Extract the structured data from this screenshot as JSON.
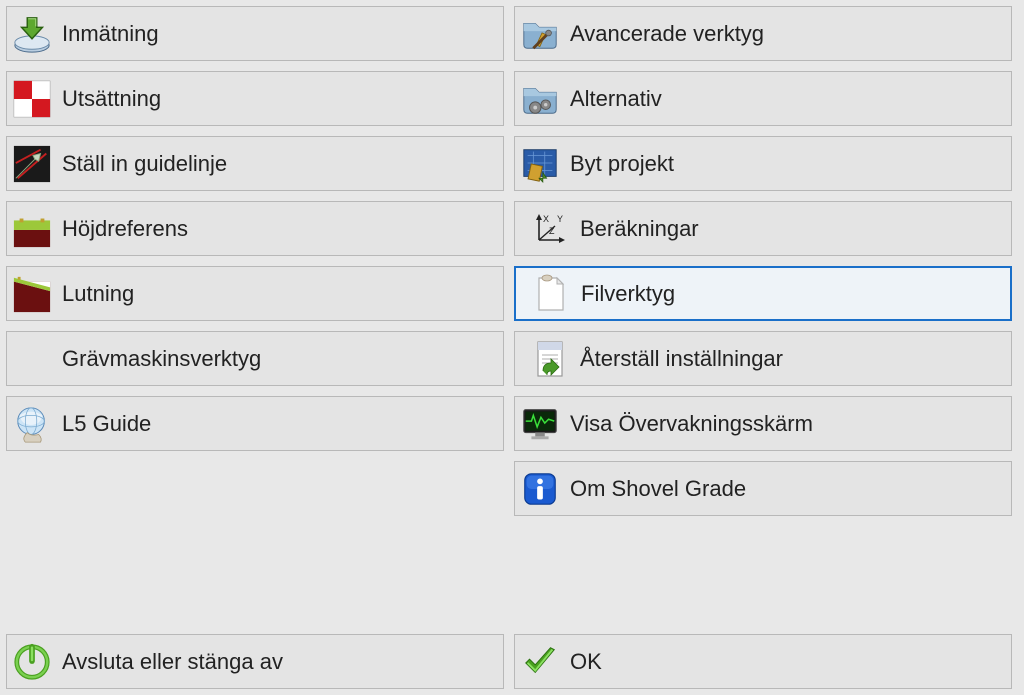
{
  "leftColumn": [
    {
      "id": "inmatning",
      "label": "Inmätning",
      "icon": "download-disk"
    },
    {
      "id": "utsattning",
      "label": "Utsättning",
      "icon": "red-squares"
    },
    {
      "id": "guidelinje",
      "label": "Ställ in guidelinje",
      "icon": "guideline-arrow"
    },
    {
      "id": "hojdreferens",
      "label": "Höjdreferens",
      "icon": "height-ref"
    },
    {
      "id": "lutning",
      "label": "Lutning",
      "icon": "slope"
    },
    {
      "id": "gravmaskin",
      "label": "Grävmaskinsverktyg",
      "icon": null
    },
    {
      "id": "l5guide",
      "label": "L5 Guide",
      "icon": "globe"
    }
  ],
  "rightColumn": [
    {
      "id": "avancerade",
      "label": "Avancerade verktyg",
      "icon": "folder-tools"
    },
    {
      "id": "alternativ",
      "label": "Alternativ",
      "icon": "folder-gears"
    },
    {
      "id": "bytprojekt",
      "label": "Byt projekt",
      "icon": "blueprint"
    },
    {
      "id": "berakningar",
      "label": "Beräkningar",
      "icon": "axes"
    },
    {
      "id": "filverktyg",
      "label": "Filverktyg",
      "icon": "file",
      "selected": true
    },
    {
      "id": "aterstall",
      "label": "Återställ inställningar",
      "icon": "restore-page"
    },
    {
      "id": "overvak",
      "label": "Visa Övervakningsskärm",
      "icon": "monitor"
    },
    {
      "id": "om",
      "label": "Om Shovel Grade",
      "icon": "info"
    }
  ],
  "bottom": {
    "exit": "Avsluta eller stänga av",
    "ok": "OK"
  }
}
